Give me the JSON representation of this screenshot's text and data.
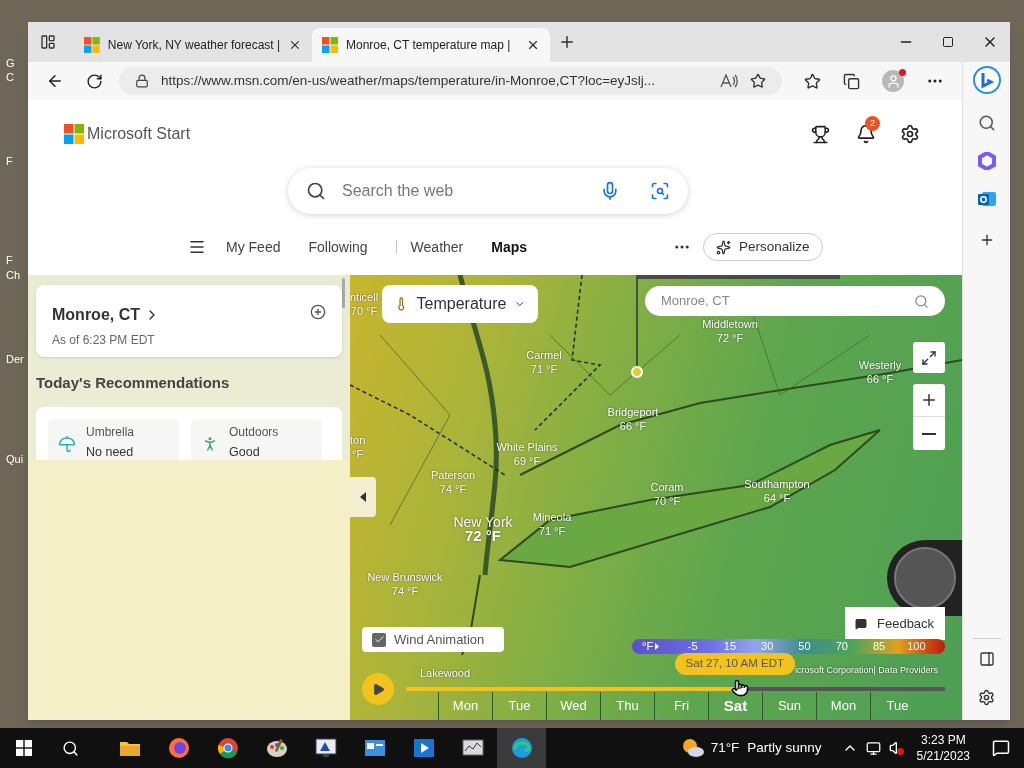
{
  "desktop": {
    "icon_labels": [
      "G",
      "C",
      "F",
      "F",
      "Ch",
      "Der",
      "Qui"
    ]
  },
  "browser": {
    "tabs": [
      {
        "title": "New York, NY weather forecast |",
        "selected": false
      },
      {
        "title": "Monroe, CT temperature map |",
        "selected": true
      }
    ],
    "url": "https://www.msn.com/en-us/weather/maps/temperature/in-Monroe,CT?loc=eyJslj..."
  },
  "header": {
    "logo_text": "Microsoft Start",
    "notification_count": "2",
    "search_placeholder": "Search the web",
    "nav": [
      {
        "label": "My Feed",
        "selected": false
      },
      {
        "label": "Following",
        "selected": false
      },
      {
        "label": "Weather",
        "selected": false
      },
      {
        "label": "Maps",
        "selected": true
      }
    ],
    "personalize": "Personalize"
  },
  "side_panel": {
    "location": "Monroe, CT",
    "as_of": "As of 6:23 PM EDT",
    "recommendations_title": "Today's Recommendations",
    "recommendations": [
      {
        "kind": "umbrella",
        "title": "Umbrella",
        "value": "No need"
      },
      {
        "kind": "outdoors",
        "title": "Outdoors",
        "value": "Good"
      }
    ]
  },
  "map": {
    "layer": "Temperature",
    "search_placeholder": "Monroe, CT",
    "labels": [
      {
        "city": "nticell",
        "temp": "70 °F"
      },
      {
        "city": "Middletown",
        "temp": "72 °F"
      },
      {
        "city": "Carmel",
        "temp": "71 °F"
      },
      {
        "city": "Westerly",
        "temp": "66 °F"
      },
      {
        "city": "Bridgeport",
        "temp": "66 °F"
      },
      {
        "city": "ton",
        "temp": "°F"
      },
      {
        "city": "White Plains",
        "temp": "69 °F"
      },
      {
        "city": "Paterson",
        "temp": "74 °F"
      },
      {
        "city": "Coram",
        "temp": "70 °F"
      },
      {
        "city": "Southampton",
        "temp": "64 °F"
      },
      {
        "city": "New York",
        "temp": "72 °F"
      },
      {
        "city": "Mineola",
        "temp": "71 °F"
      },
      {
        "city": "New Brunswick",
        "temp": "74 °F"
      },
      {
        "city": "Lakewood"
      }
    ],
    "wind_animation": {
      "label": "Wind Animation",
      "checked": true
    },
    "feedback": "Feedback",
    "legend": {
      "unit": "°F",
      "values": [
        "-5",
        "15",
        "30",
        "50",
        "70",
        "85",
        "100"
      ]
    },
    "attribution": "icrosoft Corporation| Data Providers",
    "timeline": {
      "tooltip": "Sat 27, 10 AM EDT",
      "level": 0.61,
      "days": [
        {
          "label": "Mon",
          "selected": false
        },
        {
          "label": "Tue",
          "selected": false
        },
        {
          "label": "Wed",
          "selected": false
        },
        {
          "label": "Thu",
          "selected": false
        },
        {
          "label": "Fri",
          "selected": false
        },
        {
          "label": "Sat",
          "selected": true
        },
        {
          "label": "Sun",
          "selected": false
        },
        {
          "label": "Mon",
          "selected": false
        },
        {
          "label": "Tue",
          "selected": false
        }
      ]
    }
  },
  "taskbar": {
    "apps": [
      {
        "kind": "explorer",
        "active": false
      },
      {
        "kind": "firefox",
        "active": false
      },
      {
        "kind": "chrome",
        "active": false
      },
      {
        "kind": "paint",
        "active": false
      },
      {
        "kind": "monitor",
        "active": false
      },
      {
        "kind": "card",
        "active": false
      },
      {
        "kind": "media",
        "active": false
      },
      {
        "kind": "tool",
        "active": false
      },
      {
        "kind": "edge",
        "active": true
      }
    ],
    "weather": {
      "temp": "71°F",
      "condition": "Partly sunny"
    },
    "time": "3:23 PM",
    "date": "5/21/2023"
  }
}
